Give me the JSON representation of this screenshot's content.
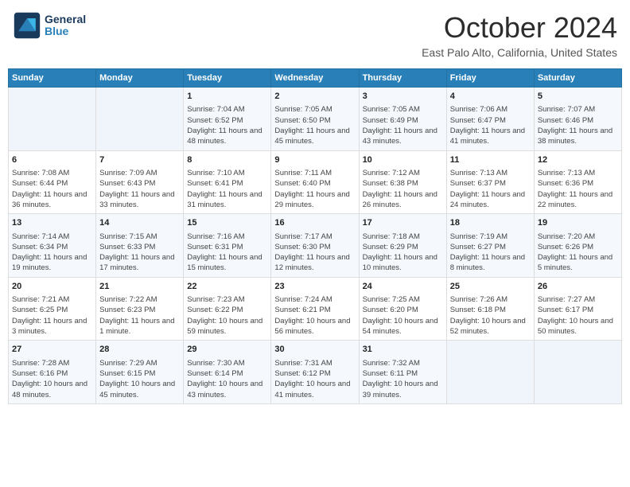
{
  "header": {
    "logo_general": "General",
    "logo_blue": "Blue",
    "title": "October 2024",
    "location": "East Palo Alto, California, United States"
  },
  "days_of_week": [
    "Sunday",
    "Monday",
    "Tuesday",
    "Wednesday",
    "Thursday",
    "Friday",
    "Saturday"
  ],
  "weeks": [
    [
      {
        "day": "",
        "info": ""
      },
      {
        "day": "",
        "info": ""
      },
      {
        "day": "1",
        "info": "Sunrise: 7:04 AM\nSunset: 6:52 PM\nDaylight: 11 hours and 48 minutes."
      },
      {
        "day": "2",
        "info": "Sunrise: 7:05 AM\nSunset: 6:50 PM\nDaylight: 11 hours and 45 minutes."
      },
      {
        "day": "3",
        "info": "Sunrise: 7:05 AM\nSunset: 6:49 PM\nDaylight: 11 hours and 43 minutes."
      },
      {
        "day": "4",
        "info": "Sunrise: 7:06 AM\nSunset: 6:47 PM\nDaylight: 11 hours and 41 minutes."
      },
      {
        "day": "5",
        "info": "Sunrise: 7:07 AM\nSunset: 6:46 PM\nDaylight: 11 hours and 38 minutes."
      }
    ],
    [
      {
        "day": "6",
        "info": "Sunrise: 7:08 AM\nSunset: 6:44 PM\nDaylight: 11 hours and 36 minutes."
      },
      {
        "day": "7",
        "info": "Sunrise: 7:09 AM\nSunset: 6:43 PM\nDaylight: 11 hours and 33 minutes."
      },
      {
        "day": "8",
        "info": "Sunrise: 7:10 AM\nSunset: 6:41 PM\nDaylight: 11 hours and 31 minutes."
      },
      {
        "day": "9",
        "info": "Sunrise: 7:11 AM\nSunset: 6:40 PM\nDaylight: 11 hours and 29 minutes."
      },
      {
        "day": "10",
        "info": "Sunrise: 7:12 AM\nSunset: 6:38 PM\nDaylight: 11 hours and 26 minutes."
      },
      {
        "day": "11",
        "info": "Sunrise: 7:13 AM\nSunset: 6:37 PM\nDaylight: 11 hours and 24 minutes."
      },
      {
        "day": "12",
        "info": "Sunrise: 7:13 AM\nSunset: 6:36 PM\nDaylight: 11 hours and 22 minutes."
      }
    ],
    [
      {
        "day": "13",
        "info": "Sunrise: 7:14 AM\nSunset: 6:34 PM\nDaylight: 11 hours and 19 minutes."
      },
      {
        "day": "14",
        "info": "Sunrise: 7:15 AM\nSunset: 6:33 PM\nDaylight: 11 hours and 17 minutes."
      },
      {
        "day": "15",
        "info": "Sunrise: 7:16 AM\nSunset: 6:31 PM\nDaylight: 11 hours and 15 minutes."
      },
      {
        "day": "16",
        "info": "Sunrise: 7:17 AM\nSunset: 6:30 PM\nDaylight: 11 hours and 12 minutes."
      },
      {
        "day": "17",
        "info": "Sunrise: 7:18 AM\nSunset: 6:29 PM\nDaylight: 11 hours and 10 minutes."
      },
      {
        "day": "18",
        "info": "Sunrise: 7:19 AM\nSunset: 6:27 PM\nDaylight: 11 hours and 8 minutes."
      },
      {
        "day": "19",
        "info": "Sunrise: 7:20 AM\nSunset: 6:26 PM\nDaylight: 11 hours and 5 minutes."
      }
    ],
    [
      {
        "day": "20",
        "info": "Sunrise: 7:21 AM\nSunset: 6:25 PM\nDaylight: 11 hours and 3 minutes."
      },
      {
        "day": "21",
        "info": "Sunrise: 7:22 AM\nSunset: 6:23 PM\nDaylight: 11 hours and 1 minute."
      },
      {
        "day": "22",
        "info": "Sunrise: 7:23 AM\nSunset: 6:22 PM\nDaylight: 10 hours and 59 minutes."
      },
      {
        "day": "23",
        "info": "Sunrise: 7:24 AM\nSunset: 6:21 PM\nDaylight: 10 hours and 56 minutes."
      },
      {
        "day": "24",
        "info": "Sunrise: 7:25 AM\nSunset: 6:20 PM\nDaylight: 10 hours and 54 minutes."
      },
      {
        "day": "25",
        "info": "Sunrise: 7:26 AM\nSunset: 6:18 PM\nDaylight: 10 hours and 52 minutes."
      },
      {
        "day": "26",
        "info": "Sunrise: 7:27 AM\nSunset: 6:17 PM\nDaylight: 10 hours and 50 minutes."
      }
    ],
    [
      {
        "day": "27",
        "info": "Sunrise: 7:28 AM\nSunset: 6:16 PM\nDaylight: 10 hours and 48 minutes."
      },
      {
        "day": "28",
        "info": "Sunrise: 7:29 AM\nSunset: 6:15 PM\nDaylight: 10 hours and 45 minutes."
      },
      {
        "day": "29",
        "info": "Sunrise: 7:30 AM\nSunset: 6:14 PM\nDaylight: 10 hours and 43 minutes."
      },
      {
        "day": "30",
        "info": "Sunrise: 7:31 AM\nSunset: 6:12 PM\nDaylight: 10 hours and 41 minutes."
      },
      {
        "day": "31",
        "info": "Sunrise: 7:32 AM\nSunset: 6:11 PM\nDaylight: 10 hours and 39 minutes."
      },
      {
        "day": "",
        "info": ""
      },
      {
        "day": "",
        "info": ""
      }
    ]
  ]
}
